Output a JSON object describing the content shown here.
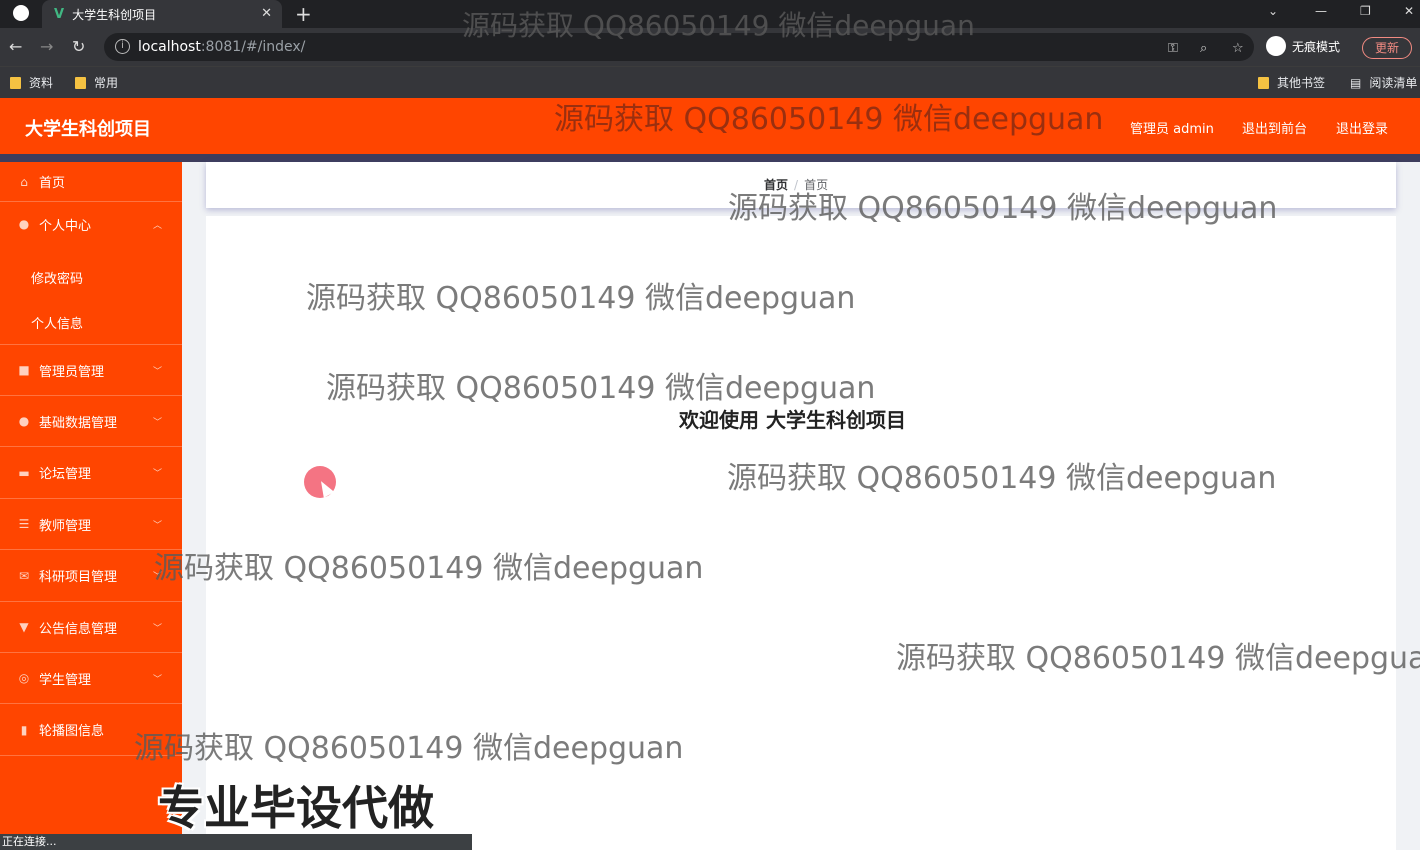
{
  "browser": {
    "tab_title": "大学生科创项目",
    "url_host": "localhost",
    "url_rest": ":8081/#/index/",
    "incognito_label": "无痕模式",
    "update_label": "更新",
    "bookmarks": [
      "资料",
      "常用"
    ],
    "bookmarks_right": [
      "其他书签",
      "阅读清单"
    ]
  },
  "header": {
    "logo": "大学生科创项目",
    "admin_label": "管理员 admin",
    "to_frontend": "退出到前台",
    "logout": "退出登录"
  },
  "sidebar": {
    "items": [
      {
        "label": "首页",
        "icon": "home-icon"
      },
      {
        "label": "个人中心",
        "icon": "user-icon"
      },
      {
        "label": "管理员管理",
        "icon": "admin-icon"
      },
      {
        "label": "基础数据管理",
        "icon": "user-icon"
      },
      {
        "label": "论坛管理",
        "icon": "forum-icon"
      },
      {
        "label": "教师管理",
        "icon": "list-icon"
      },
      {
        "label": "科研项目管理",
        "icon": "mail-icon"
      },
      {
        "label": "公告信息管理",
        "icon": "pin-icon"
      },
      {
        "label": "学生管理",
        "icon": "compass-icon"
      },
      {
        "label": "轮播图信息",
        "icon": "chart-icon"
      }
    ],
    "sub_items": [
      "修改密码",
      "个人信息"
    ]
  },
  "breadcrumb": {
    "home": "首页",
    "current": "首页"
  },
  "main": {
    "welcome": "欢迎使用 大学生科创项目"
  },
  "watermark": "源码获取 QQ86050149 微信deepguan",
  "promo": "专业毕设代做",
  "status": "正在连接..."
}
